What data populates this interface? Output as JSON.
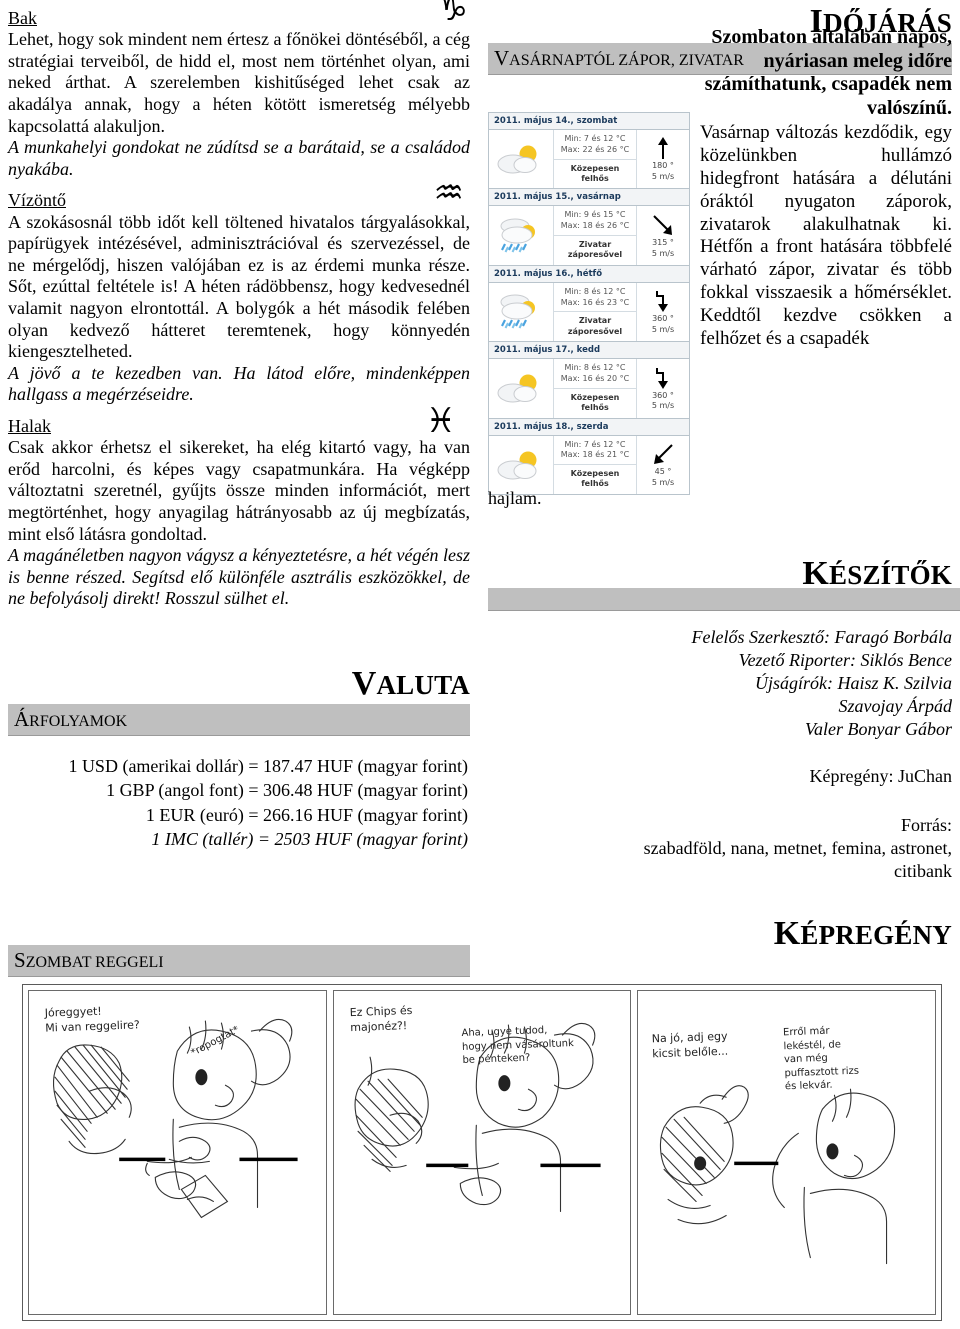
{
  "horoscope": {
    "signs": [
      {
        "name": "Bak",
        "zodiac_glyph": "♑",
        "zodiac_icon": "capricorn-icon",
        "body": "Lehet, hogy sok mindent nem értesz a főnökei döntéséből, a cég stratégiai terveiből, de hidd el, most nem történhet olyan, ami neked árthat. A szerelemben kishitűséged lehet csak az akadálya annak, hogy a héten kötött ismeretség mélyebb kapcsolattá alakuljon.",
        "italic": "A munkahelyi gondokat ne zúdítsd se a barátaid, se a családod nyakába."
      },
      {
        "name": "Vízöntő",
        "zodiac_glyph": "♒",
        "zodiac_icon": "aquarius-icon",
        "body": "A szokásosnál több időt kell töltened hivatalos tárgyalásokkal, papírügyek intézésével, adminisztrációval és szervezéssel, de ne mérgelődj, hiszen valójában ez is az érdemi munka része. Sőt, ezúttal feltétele is! A héten rádöbbensz, hogy kedvesednél valamit nagyon elrontottál. A bolygók a hét második felében olyan kedvező hátteret teremtenek, hogy könnyedén kiengesztelheted.",
        "italic": "A jövő a te kezedben van. Ha látod előre, mindenképpen hallgass a megérzéseidre."
      },
      {
        "name": "Halak",
        "zodiac_glyph": "♓",
        "zodiac_icon": "pisces-icon",
        "body": "Csak akkor érhetsz el sikereket, ha elég kitartó vagy, ha van erőd harcolni, és képes vagy csapatmunkára. Ha végképp változtatni szeretnél, gyűjts össze minden információt, mert megtörténhet, hogy anyagilag hátrányosabb az új megbízatás, mint első látásra gondoltad.",
        "italic": "A magánéletben nagyon vágysz a kényeztetésre, a hét végén lesz is benne részed. Segítsd elő különféle asztrális eszközökkel, de ne befolyásolj direkt! Rosszul sülhet el."
      }
    ]
  },
  "valuta": {
    "title_cap": "V",
    "title_rest": "ALUTA",
    "bar_cap": "Á",
    "bar_rest": "RFOLYAMOK",
    "rates": [
      "1 USD (amerikai dollár) = 187.47 HUF (magyar forint)",
      "1 GBP (angol font) = 306.48 HUF (magyar forint)",
      "1 EUR (euró) = 266.16 HUF (magyar forint)"
    ],
    "rate_italic": "1 IMC (tallér) = 2503 HUF (magyar forint)"
  },
  "reggeli": {
    "bar_cap": "S",
    "bar_rest": "ZOMBAT REGGELI"
  },
  "weather": {
    "title_cap": "I",
    "title_rest": "DŐJÁRÁS",
    "bar_cap": "V",
    "bar_rest": "ASÁRNAPTÓL ZÁPOR, ZIVATAR",
    "lead": "Szombaton általában napos, nyáriasan meleg időre számíthatunk, csapadék nem valószínű.",
    "body": "Vasárnap változás kezdődik, egy közelünkben hullámzó hidegfront hatására a délutáni óráktól nyugaton záporok, zivatarok alakulhatnak ki. Hétfőn a front hatására többfelé várható zápor, zivatar és több fokkal visszaesik a hőmérséklet. Keddtől kezdve csökken a felhőzet és a csapadék",
    "body_tail": "hajlam.",
    "forecast": [
      {
        "date": "2011. május 14., szombat",
        "icon": "sun-behind-cloud-icon",
        "min": "Min: 7 és 12 °C",
        "max": "Max: 22 és 26 °C",
        "condition": "Közepesen felhős",
        "wind_dir": "180 °",
        "wind_speed": "5 m/s",
        "arrow": "up"
      },
      {
        "date": "2011. május 15., vasárnap",
        "icon": "rain-shower-icon",
        "min": "Min: 9 és 15 °C",
        "max": "Max: 18 és 26 °C",
        "condition": "Zivatar záporesővel",
        "wind_dir": "315 °",
        "wind_speed": "5 m/s",
        "arrow": "down-right"
      },
      {
        "date": "2011. május 16., hétfő",
        "icon": "rain-shower-icon",
        "min": "Min: 8 és 12 °C",
        "max": "Max: 16 és 23 °C",
        "condition": "Zivatar záporesővel",
        "wind_dir": "360 °",
        "wind_speed": "5 m/s",
        "arrow": "down"
      },
      {
        "date": "2011. május 17., kedd",
        "icon": "sun-behind-cloud-icon",
        "min": "Min: 8 és 12 °C",
        "max": "Max: 16 és 20 °C",
        "condition": "Közepesen felhős",
        "wind_dir": "360 °",
        "wind_speed": "5 m/s",
        "arrow": "down"
      },
      {
        "date": "2011. május 18., szerda",
        "icon": "sun-behind-cloud-icon",
        "min": "Min: 7 és 12 °C",
        "max": "Max: 18 és 21 °C",
        "condition": "Közepesen felhős",
        "wind_dir": "45 °",
        "wind_speed": "5 m/s",
        "arrow": "down-left"
      }
    ]
  },
  "keszitok": {
    "title_cap": "K",
    "title_rest": "ÉSZÍTŐK",
    "lines": [
      "Felelős Szerkesztő: Faragó Borbála",
      "Vezető Riporter: Siklós Bence",
      "Újságírók: Haisz K. Szilvia",
      "Szavojay Árpád",
      "Valer Bonyar Gábor"
    ],
    "kepregeny_line": "Képregény: JuChan",
    "forras_label": "Forrás:",
    "forras_line1": "szabadföld, nana, metnet, femina, astronet,",
    "forras_line2": "citibank"
  },
  "kepregeny": {
    "title_cap": "K",
    "title_rest": "ÉPREGÉNY"
  },
  "comic": {
    "panels": [
      {
        "bubble1": "Jóreggyet!\nMi van reggelire?",
        "bubble2": "*ropogtat*"
      },
      {
        "bubble1": "Ez Chips és\nmajonéz?!",
        "bubble2": "Aha, ugye tudod,\nhogy nem vásároltunk\nbe pénteken?"
      },
      {
        "bubble1": "Na jó, adj egy\nkicsit belőle...",
        "bubble2": "Erről már\nlekéstél, de\nvan még\npuffasztott rizs\nés lekvár."
      }
    ]
  },
  "colors": {
    "bar_gray": "#bfbfbf",
    "table_border": "#b9c4cc",
    "table_head_text": "#1b3a5c"
  }
}
